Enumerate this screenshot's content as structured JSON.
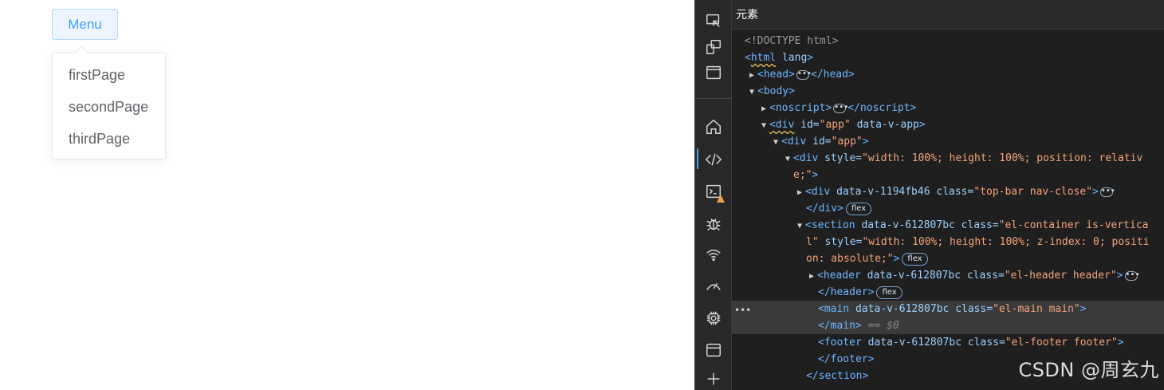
{
  "page": {
    "menu_button": "Menu",
    "dropdown_items": [
      "firstPage",
      "secondPage",
      "thirdPage"
    ]
  },
  "devtools": {
    "panel_title": "元素",
    "activity_icons": [
      "inspect-icon",
      "device-emulation-icon",
      "window-icon",
      "home-icon",
      "elements-icon",
      "console-icon",
      "bug-icon",
      "network-icon",
      "performance-icon",
      "memory-chip-icon",
      "application-icon",
      "add-tool-icon"
    ],
    "dom_tree": {
      "l1": "<!DOCTYPE html>",
      "l2_tag": "html",
      "l2_attr": " lang",
      "l3_open": "<head>",
      "l3_close": "</head>",
      "l4": "<body>",
      "l5_open": "<noscript>",
      "l5_close": "</noscript>",
      "l6_tag": "<div",
      "l6_a1": " id=",
      "l6_v1": "\"app\"",
      "l6_a2": " data-v-app",
      "l6_end": ">",
      "l7_tag": "<div",
      "l7_a1": " id=",
      "l7_v1": "\"app\"",
      "l7_end": ">",
      "l8_tag": "<div",
      "l8_a1": " style=",
      "l8_v1": "\"width: 100%; height: 100%; position: relativ",
      "l9_v1": "e;\"",
      "l9_end": ">",
      "l10_tag": "<div",
      "l10_a1": " data-v-1194fb46 class=",
      "l10_v1": "\"top-bar nav-close\"",
      "l10_end": ">",
      "l11": "</div>",
      "l12_tag": "<section",
      "l12_a1": " data-v-612807bc class=",
      "l12_v1": "\"el-container is-vertica",
      "l13_v1": "l\"",
      "l13_a1": " style=",
      "l13_v2": "\"width: 100%; height: 100%; z-index: 0; positi",
      "l14_v1": "on: absolute;\"",
      "l14_end": ">",
      "l15_tag": "<header",
      "l15_a1": " data-v-612807bc class=",
      "l15_v1": "\"el-header header\"",
      "l15_end": ">",
      "l16": "</header>",
      "l17_tag": "<main",
      "l17_a1": " data-v-612807bc class=",
      "l17_v1": "\"el-main main\"",
      "l17_end": ">",
      "l18": "</main>",
      "l18_dim": " == $0",
      "l19_tag": "<footer",
      "l19_a1": " data-v-612807bc class=",
      "l19_v1": "\"el-footer footer\"",
      "l19_end": ">",
      "l20": "</footer>",
      "l21": "</section>",
      "badge": "flex",
      "ellipsis": "•••"
    },
    "row_dots": "•••"
  },
  "watermark": "CSDN @周玄九"
}
